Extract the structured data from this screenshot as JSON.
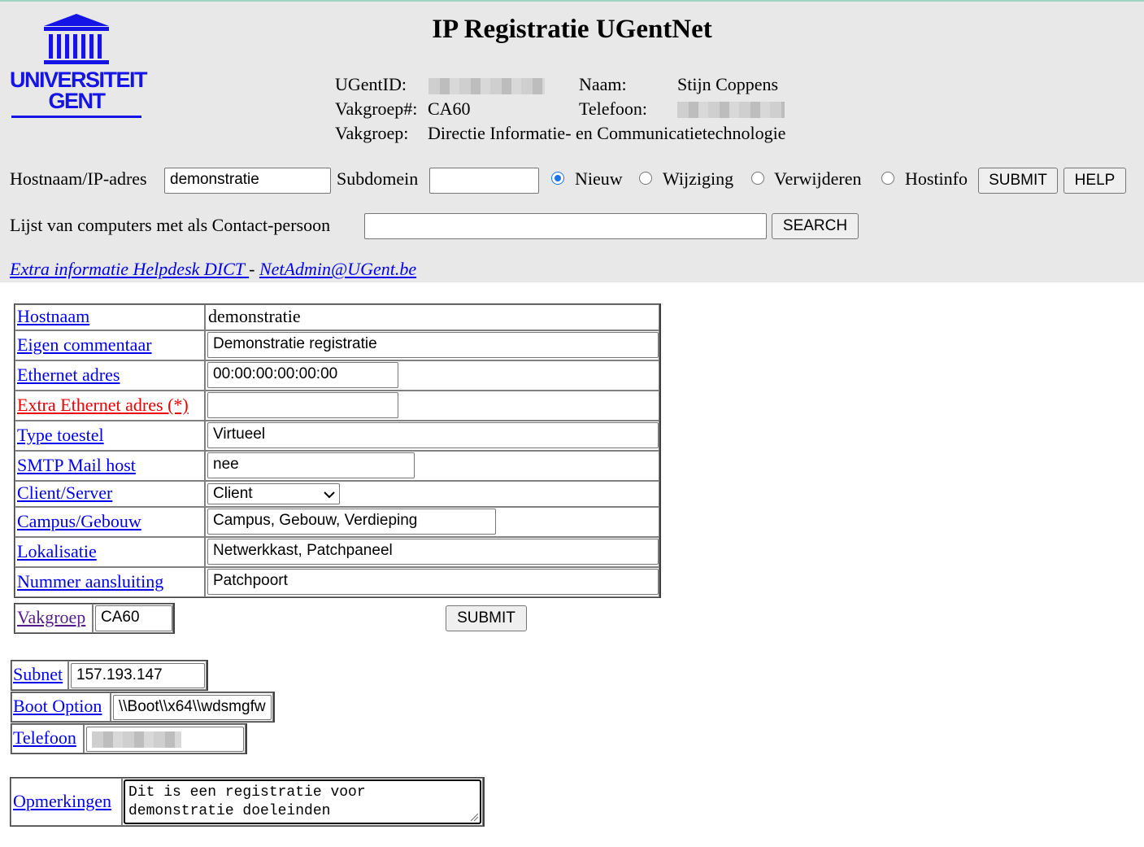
{
  "header": {
    "title": "IP Registratie UGentNet",
    "logo": {
      "line1": "UNIVERSITEIT",
      "line2": "GENT",
      "color": "#1414e6"
    },
    "info": {
      "ugentid_label": "UGentID:",
      "naam_label": "Naam:",
      "naam_value": "Stijn Coppens",
      "vakgroepnr_label": "Vakgroep#:",
      "vakgroepnr_value": "CA60",
      "telefoon_label": "Telefoon:",
      "vakgroep_label": "Vakgroep:",
      "vakgroep_value": "Directie Informatie- en Communicatietechnologie"
    },
    "search_row": {
      "hostname_label": "Hostnaam/IP-adres",
      "hostname_value": "demonstratie",
      "subdomain_label": "Subdomein",
      "subdomain_value": "",
      "radio_options": [
        {
          "label": "Nieuw",
          "checked": true
        },
        {
          "label": "Wijziging",
          "checked": false
        },
        {
          "label": "Verwijderen",
          "checked": false
        },
        {
          "label": "Hostinfo",
          "checked": false
        }
      ],
      "submit_label": "SUBMIT",
      "help_label": "HELP"
    },
    "contact_row": {
      "label": "Lijst van computers met als Contact-persoon",
      "value": "",
      "search_label": "SEARCH"
    },
    "links": {
      "helpdesk": "Extra informatie Helpdesk DICT ",
      "separator": " - ",
      "netadmin": "NetAdmin@UGent.be"
    }
  },
  "form": {
    "hostnaam_label": "Hostnaam",
    "hostnaam_value": "demonstratie",
    "commentaar_label": "Eigen commentaar",
    "commentaar_value": "Demonstratie registratie",
    "ethernet_label": "Ethernet adres",
    "ethernet_value": "00:00:00:00:00:00",
    "extra_ethernet_label": "Extra Ethernet adres (*)",
    "extra_ethernet_value": "",
    "type_label": "Type toestel",
    "type_value": "Virtueel",
    "smtp_label": "SMTP Mail host",
    "smtp_value": "nee",
    "clientserver_label": "Client/Server",
    "clientserver_value": "Client",
    "campus_label": "Campus/Gebouw",
    "campus_value": "Campus, Gebouw, Verdieping",
    "lokalisatie_label": "Lokalisatie",
    "lokalisatie_value": "Netwerkkast, Patchpaneel",
    "nummer_label": "Nummer aansluiting",
    "nummer_value": "Patchpoort",
    "vakgroep_label": "Vakgroep",
    "vakgroep_value": "CA60",
    "submit_label": "SUBMIT"
  },
  "extra": {
    "subnet_label": "Subnet",
    "subnet_value": "157.193.147",
    "boot_label": "Boot Option",
    "boot_value": "\\\\Boot\\\\x64\\\\wdsmgfw",
    "telefoon_label": "Telefoon",
    "opmerkingen_label": "Opmerkingen",
    "opmerkingen_value": "Dit is een registratie voor\ndemonstratie doeleinden"
  },
  "colors": {
    "header_bg": "#e8e8e8",
    "link": "#0000ee",
    "visited": "#551a8b",
    "required": "#ee0000",
    "radio_accent": "#1a73e8"
  }
}
